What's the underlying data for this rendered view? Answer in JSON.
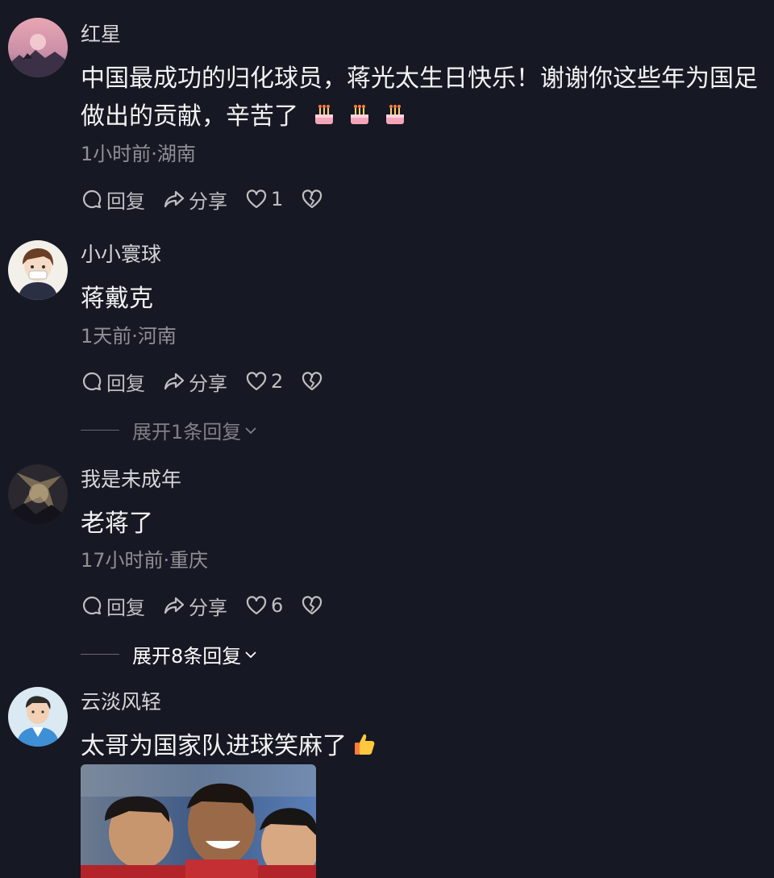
{
  "comments": [
    {
      "username": "红星",
      "text": "中国最成功的归化球员，蒋光太生日快乐！谢谢你这些年为国足做出的贡献，辛苦了",
      "emojis": [
        "cake-emoji",
        "cake-emoji",
        "cake-emoji"
      ],
      "meta": "1小时前·湖南",
      "reply_label": "回复",
      "share_label": "分享",
      "likes": "1"
    },
    {
      "username": "小小寰球",
      "text": "蒋戴克",
      "meta": "1天前·河南",
      "reply_label": "回复",
      "share_label": "分享",
      "likes": "2",
      "expand_label": "展开1条回复"
    },
    {
      "username": "我是未成年",
      "text": "老蒋了",
      "meta": "17小时前·重庆",
      "reply_label": "回复",
      "share_label": "分享",
      "likes": "6",
      "expand_label": "展开8条回复"
    },
    {
      "username": "云淡风轻",
      "text": "太哥为国家队进球笑麻了",
      "emojis": [
        "thumbs-up-emoji"
      ],
      "has_photo": true
    }
  ],
  "colors": {
    "background": "#161823",
    "text_primary": "#f2f2f2",
    "text_secondary": "#8a8b91"
  }
}
